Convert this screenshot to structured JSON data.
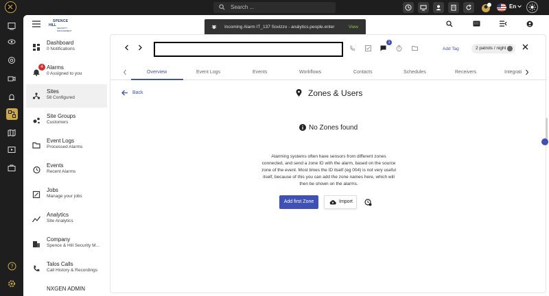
{
  "topbar": {
    "search_placeholder": "Search ...",
    "language": "En"
  },
  "toast": {
    "message": "Incoming Alarm IT_137 Sovizzo - analytics.people.enter",
    "action": "View"
  },
  "brand": {
    "line1": "SPENCE",
    "line2": "HILL",
    "line3": "SECURITY MANAGEMENT"
  },
  "sidebar": {
    "items": [
      {
        "title": "Dashboard",
        "subtitle": "0 Notifications",
        "icon": "dashboard-icon"
      },
      {
        "title": "Alarms",
        "subtitle": "0 Assigned to you",
        "icon": "bell-icon",
        "badge": "4"
      },
      {
        "title": "Sites",
        "subtitle": "58 Configured",
        "icon": "sites-icon",
        "active": true
      },
      {
        "title": "Site Groups",
        "subtitle": "Customers",
        "icon": "groups-icon"
      },
      {
        "title": "Event Logs",
        "subtitle": "Processed Alarms",
        "icon": "folder-icon"
      },
      {
        "title": "Events",
        "subtitle": "Recent Alarms",
        "icon": "history-icon"
      },
      {
        "title": "Jobs",
        "subtitle": "Manage your jobs",
        "icon": "jobs-icon"
      },
      {
        "title": "Analytics",
        "subtitle": "Site Analytics",
        "icon": "analytics-icon"
      },
      {
        "title": "Company",
        "subtitle": "Spence & Hill Security M...",
        "icon": "company-icon"
      },
      {
        "title": "Talos Calls",
        "subtitle": "Call History & Recordings",
        "icon": "phone-icon"
      },
      {
        "title": "NXGEN ADMIN",
        "subtitle": "",
        "icon": "admin-icon"
      }
    ]
  },
  "site_header": {
    "notification_count": "1",
    "add_tag": "Add Tag",
    "tag_chip": "2 patrols / night"
  },
  "tabs": [
    "Overview",
    "Event Logs",
    "Events",
    "Workflows",
    "Contacts",
    "Schedules",
    "Receivers",
    "Integrati"
  ],
  "active_tab": "Overview",
  "content": {
    "back": "Back",
    "title": "Zones & Users",
    "empty_title": "No Zones found",
    "empty_description": "Alarming systems often have sensors from different zones connected, and send a zone ID with the alarm, based on the source zone of the event. Most times the ID itself (eg 004) is not very useful itself, because of this you can add the zone names here, which will then be shown on the alarms.",
    "add_button": "Add first Zone",
    "import_button": "Import"
  },
  "colors": {
    "accent": "#3f51b5",
    "gold": "#c9a74a",
    "badge_red": "#d32f2f",
    "dark": "#1e1e1e"
  }
}
